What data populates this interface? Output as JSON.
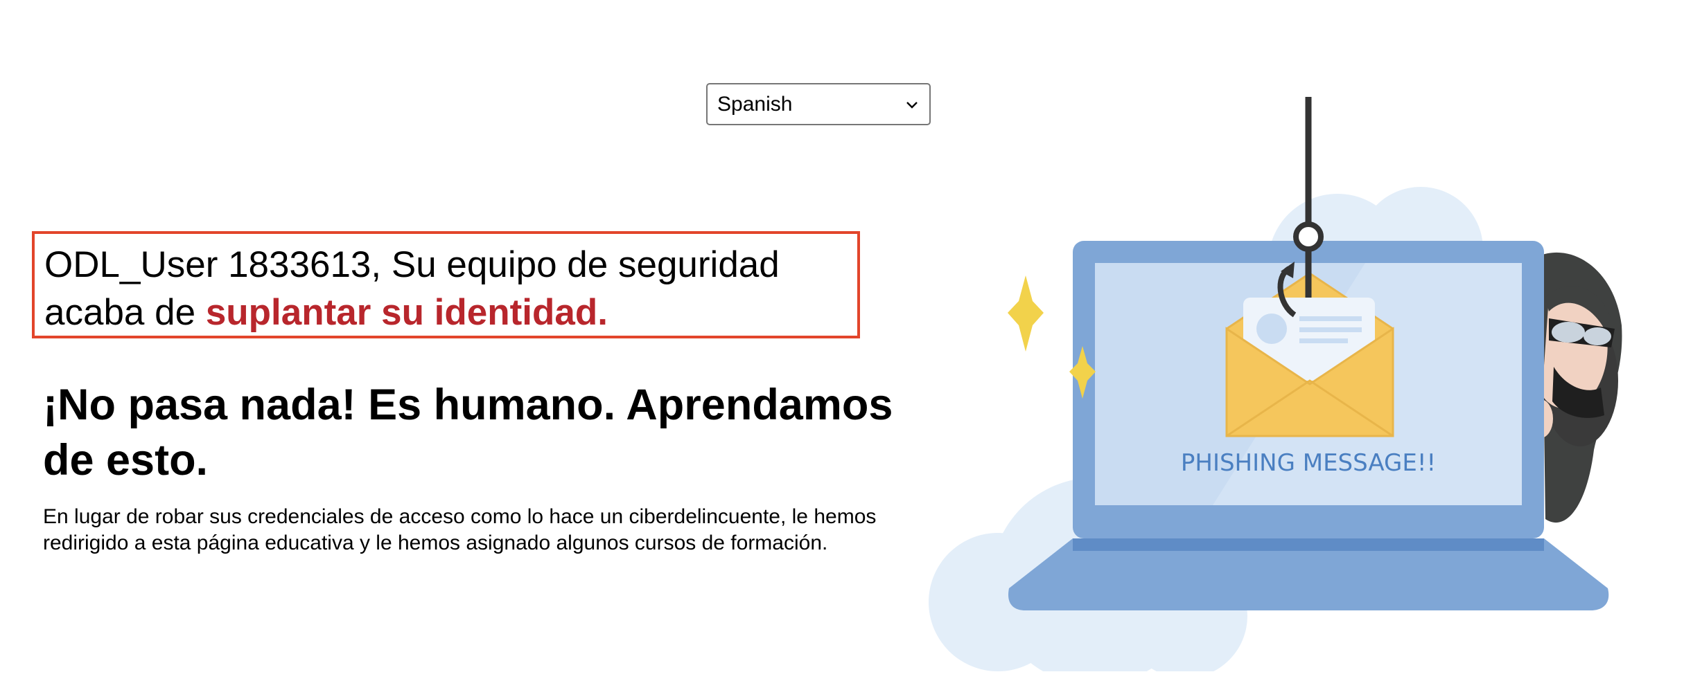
{
  "language_select": {
    "selected": "Spanish"
  },
  "alert": {
    "text_prefix": "ODL_User 1833613, Su equipo de seguridad acaba de ",
    "text_highlight": "suplantar su identidad."
  },
  "headline": "¡No pasa nada! Es humano. Aprendamos de esto.",
  "body": "En lugar de robar sus credenciales de acceso como lo hace un ciberdelincuente, le hemos redirigido a esta página educativa y le hemos asignado algunos cursos de formación.",
  "illustration": {
    "message_label": "PHISHING MESSAGE!!",
    "colors": {
      "laptop": "#7fa6d6",
      "screen": "#c9dcf2",
      "envelope": "#f5c65c",
      "cloud": "#e3eef9",
      "sparkle": "#f2d24b",
      "hook": "#333333"
    }
  }
}
